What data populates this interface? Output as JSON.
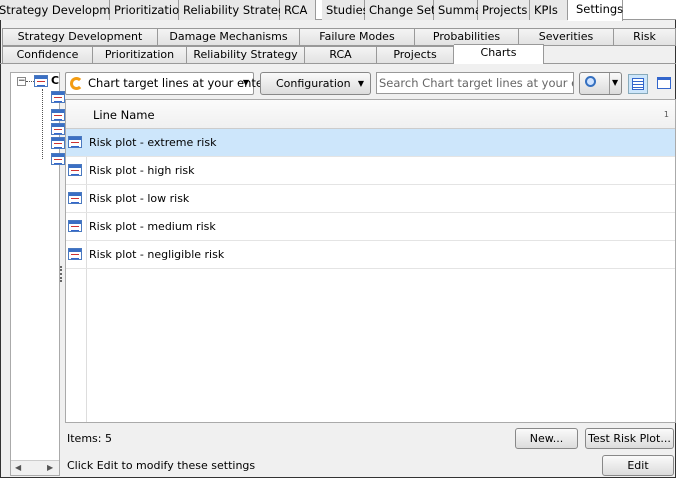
{
  "top_tabs": [
    "Strategy Development",
    "Prioritization",
    "Reliability Strategy",
    "RCA",
    "Studies",
    "Change Sets",
    "Summary",
    "Projects",
    "KPIs",
    "Settings"
  ],
  "active_top_tab": "Settings",
  "sub_tabs_row1": [
    "Strategy Development",
    "Damage Mechanisms",
    "Failure Modes",
    "Probabilities",
    "Severities",
    "Risk"
  ],
  "sub_tabs_row2": [
    "Confidence",
    "Prioritization",
    "Reliability Strategy",
    "RCA",
    "Projects",
    "Charts"
  ],
  "active_sub_tab": "Charts",
  "toolbar": {
    "query_select": "Chart target lines at your ente",
    "configuration": "Configuration",
    "search_placeholder": "Search Chart target lines at your enterprise"
  },
  "grid": {
    "column": "Line Name",
    "sort_indicator": "1",
    "rows": [
      "Risk plot - extreme risk",
      "Risk plot - high risk",
      "Risk plot - low risk",
      "Risk plot - medium risk",
      "Risk plot - negligible risk"
    ],
    "selected_index": 0
  },
  "footer": {
    "items": "Items: 5",
    "new": "New...",
    "test": "Test Risk Plot...",
    "status": "Click Edit to modify these settings",
    "edit": "Edit"
  },
  "tree": {
    "root_label": "C"
  }
}
